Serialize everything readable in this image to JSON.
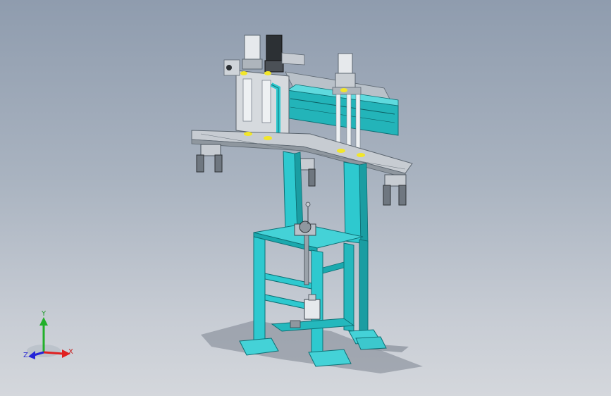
{
  "triad": {
    "x_label": "X",
    "y_label": "Y",
    "z_label": "Z",
    "colors": {
      "x": "#e02020",
      "y": "#22b02a",
      "z": "#2424d8"
    }
  },
  "model": {
    "frame_color": "#2ec9cf",
    "frame_edge": "#0d6f74",
    "plate_color": "#c7ccd2",
    "rail_color": "#1aa9ae",
    "marker_color": "#f2e62a"
  }
}
